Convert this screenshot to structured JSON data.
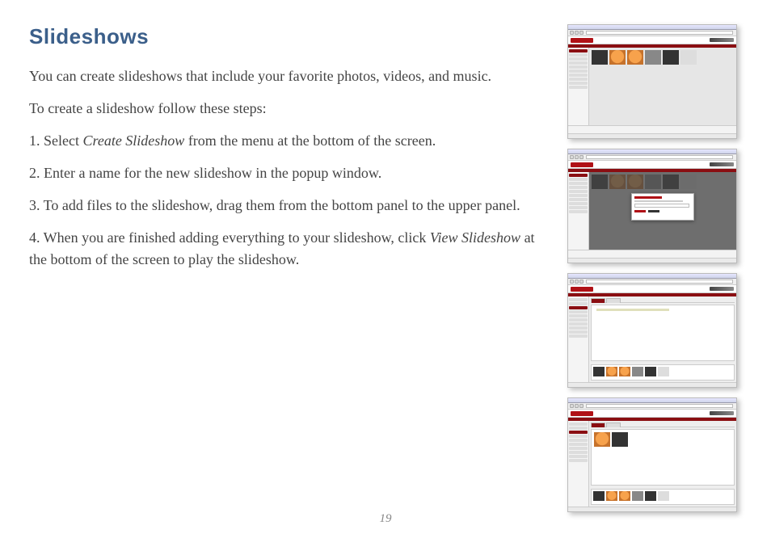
{
  "heading": "Slideshows",
  "intro": "You can create slideshows that include your favorite photos, videos, and music.",
  "lead": "To create a slideshow follow these steps:",
  "steps": {
    "s1_pre": "1. Select ",
    "s1_em": "Create Slideshow",
    "s1_post": " from the menu at the bottom of the screen.",
    "s2": "2. Enter a name for the new slideshow in the popup window.",
    "s3": "3. To add files to the slideshow, drag them from the bottom panel to the upper panel.",
    "s4_pre": "4. When you are finished adding everything to your slideshow, click ",
    "s4_em": "View Slideshow",
    "s4_post": " at the bottom of the screen to play the slideshow."
  },
  "page_number": "19",
  "screenshots": {
    "brand_left": "BUFFALO",
    "brand_right": "cloudstor",
    "popup_title": "NEW SLIDESHOW",
    "popup_ok": "OK",
    "popup_cancel": "CANCEL"
  }
}
